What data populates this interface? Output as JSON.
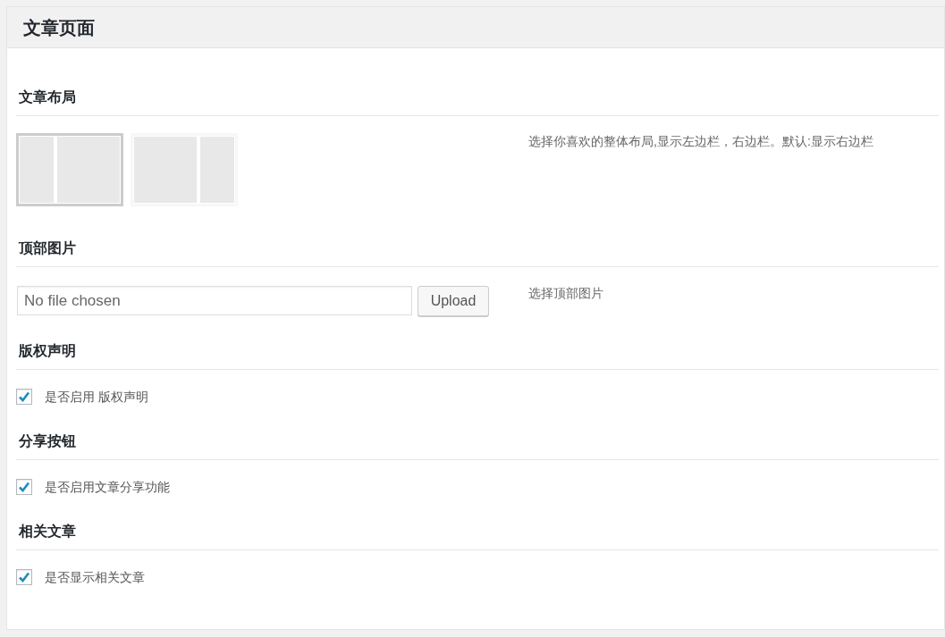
{
  "page_title": "文章页面",
  "sections": [
    {
      "kind": "layout",
      "title": "文章布局",
      "description": "选择你喜欢的整体布局,显示左边栏，右边栏。默认:显示右边栏",
      "options": [
        {
          "kind": "left-sidebar",
          "selected": true
        },
        {
          "kind": "right-sidebar",
          "selected": false
        }
      ]
    },
    {
      "kind": "upload",
      "title": "顶部图片",
      "placeholder": "No file chosen",
      "button": "Upload",
      "description": "选择顶部图片"
    },
    {
      "kind": "checkbox",
      "title": "版权声明",
      "label": "是否启用 版权声明",
      "checked": true
    },
    {
      "kind": "checkbox",
      "title": "分享按钮",
      "label": "是否启用文章分享功能",
      "checked": true
    },
    {
      "kind": "checkbox",
      "title": "相关文章",
      "label": "是否显示相关文章",
      "checked": true
    }
  ]
}
